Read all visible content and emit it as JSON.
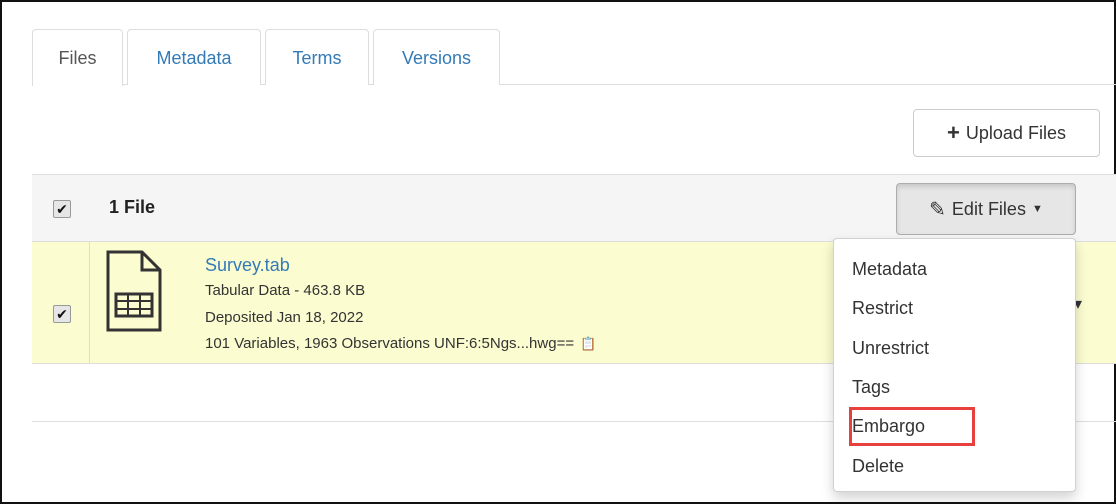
{
  "tabs": [
    {
      "label": "Files",
      "active": true
    },
    {
      "label": "Metadata",
      "active": false
    },
    {
      "label": "Terms",
      "active": false
    },
    {
      "label": "Versions",
      "active": false
    }
  ],
  "toolbar": {
    "upload_label": "Upload Files",
    "upload_icon": "plus-icon"
  },
  "file_table": {
    "file_count": "1 File",
    "edit_files_label": "Edit Files",
    "header_checked": true
  },
  "file": {
    "name": "Survey.tab",
    "type_size": "Tabular Data - 463.8 KB",
    "deposited": "Deposited Jan 18, 2022",
    "variables": "101 Variables, 1963 Observations UNF:6:5Ngs...hwg==",
    "checked": true,
    "icon": "tabular-file-icon"
  },
  "edit_menu": {
    "items": [
      "Metadata",
      "Restrict",
      "Unrestrict",
      "Tags",
      "Embargo",
      "Delete"
    ],
    "highlighted": "Embargo"
  },
  "colors": {
    "link": "#337ab7",
    "row_highlight": "#fcfcd1",
    "annotation": "#e8403c"
  }
}
